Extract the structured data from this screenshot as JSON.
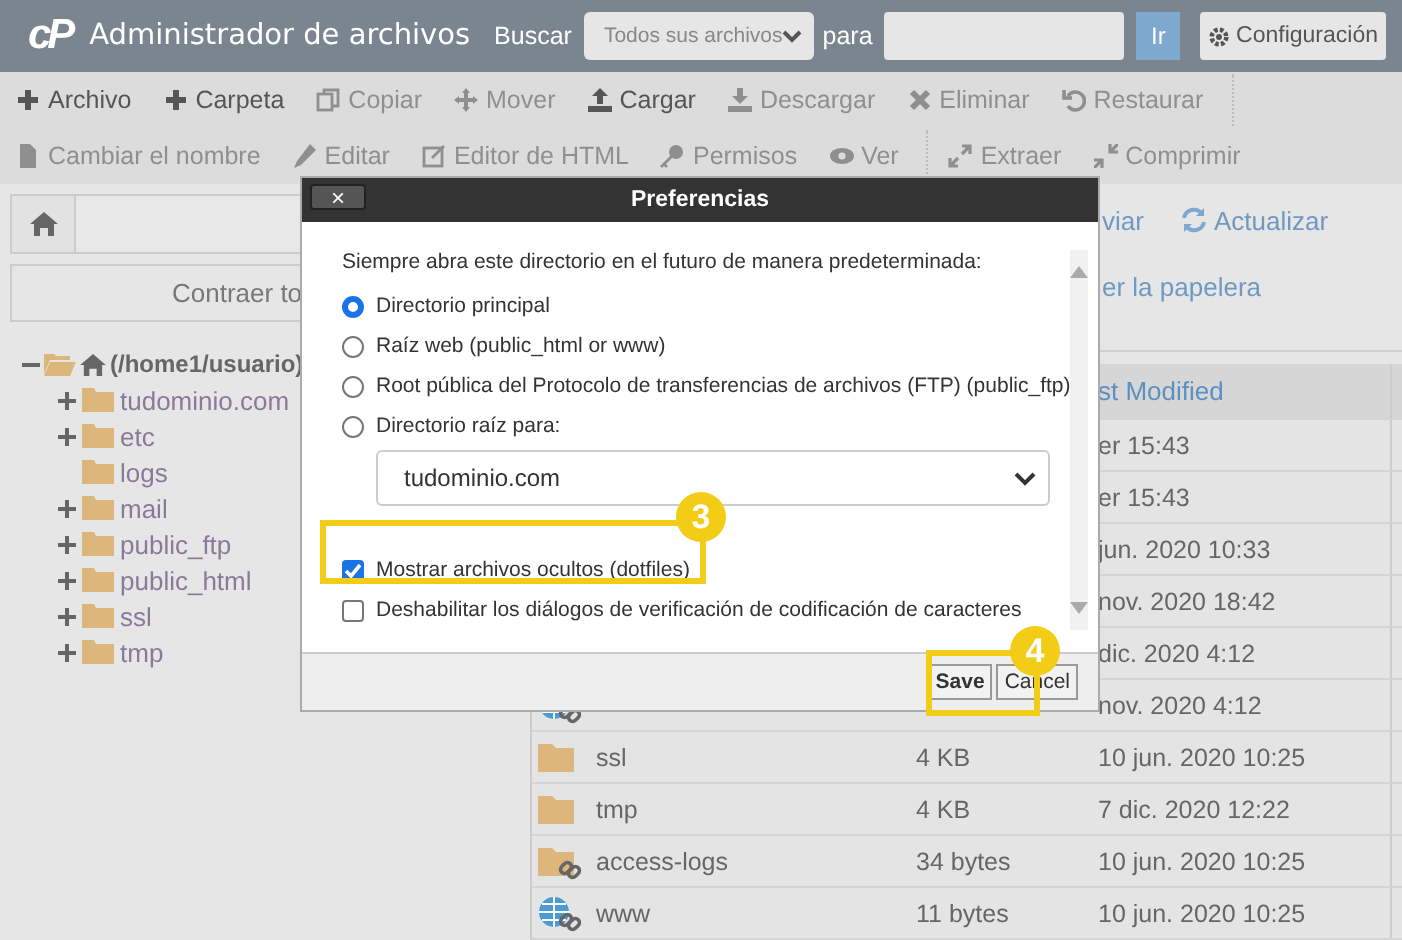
{
  "header": {
    "logo": "cP",
    "title": "Administrador de archivos",
    "search_label": "Buscar",
    "scope": "Todos sus archivos",
    "for_label": "para",
    "go": "Ir",
    "settings": "Configuración"
  },
  "toolbar": [
    [
      {
        "label": "Archivo",
        "disabled": false
      },
      {
        "label": "Carpeta",
        "disabled": false
      },
      {
        "label": "Copiar",
        "disabled": true
      },
      {
        "label": "Mover",
        "disabled": true
      },
      {
        "label": "Cargar",
        "disabled": false
      },
      {
        "label": "Descargar",
        "disabled": true
      },
      {
        "label": "Eliminar",
        "disabled": true
      },
      {
        "label": "Restaurar",
        "disabled": true
      }
    ],
    [
      {
        "label": "Cambiar el nombre",
        "disabled": true
      },
      {
        "label": "Editar",
        "disabled": true
      },
      {
        "label": "Editor de HTML",
        "disabled": true
      },
      {
        "label": "Permisos",
        "disabled": true
      },
      {
        "label": "Ver",
        "disabled": true
      },
      {
        "label": "Extraer",
        "disabled": true
      },
      {
        "label": "Comprimir",
        "disabled": true
      }
    ]
  ],
  "sidebar": {
    "collapse_button": "Contraer to",
    "tree": {
      "label": "(/home1/usuario)",
      "expanded": true,
      "children": [
        {
          "label": "tudominio.com",
          "expandable": true
        },
        {
          "label": "etc",
          "expandable": true
        },
        {
          "label": "logs",
          "expandable": false
        },
        {
          "label": "mail",
          "expandable": true
        },
        {
          "label": "public_ftp",
          "expandable": true
        },
        {
          "label": "public_html",
          "expandable": true
        },
        {
          "label": "ssl",
          "expandable": true
        },
        {
          "label": "tmp",
          "expandable": true
        }
      ]
    }
  },
  "actions": {
    "button_1": "viar",
    "refresh": "Actualizar",
    "trash_link": "er la papelera"
  },
  "table": {
    "columns": [
      "st Modified"
    ],
    "rows": [
      {
        "modified": "er 15:43"
      },
      {
        "modified": "er 15:43"
      },
      {
        "modified": "jun. 2020 10:33"
      },
      {
        "modified": "nov. 2020 18:42"
      },
      {
        "modified": "dic. 2020 4:12"
      },
      {
        "kind": "site",
        "modified": "nov. 2020 4:12"
      },
      {
        "kind": "folder",
        "name": "ssl",
        "size": "4 KB",
        "modified": "10 jun. 2020 10:25"
      },
      {
        "kind": "folder",
        "name": "tmp",
        "size": "4 KB",
        "modified": "7 dic. 2020 12:22"
      },
      {
        "kind": "link",
        "name": "access-logs",
        "size": "34 bytes",
        "modified": "10 jun. 2020 10:25"
      },
      {
        "kind": "site",
        "name": "www",
        "size": "11 bytes",
        "modified": "10 jun. 2020 10:25"
      }
    ]
  },
  "dialog": {
    "title": "Preferencias",
    "close": "×",
    "intro": "Siempre abra este directorio en el futuro de manera predeterminada:",
    "options": [
      {
        "label": "Directorio principal",
        "selected": true
      },
      {
        "label": "Raíz web (public_html or www)",
        "selected": false
      },
      {
        "label": "Root pública del Protocolo de transferencias de archivos (FTP) (public_ftp)",
        "selected": false
      },
      {
        "label": "Directorio raíz para:",
        "selected": false
      }
    ],
    "domain": "tudominio.com",
    "checkboxes": [
      {
        "label": "Mostrar archivos ocultos (dotfiles)",
        "checked": true
      },
      {
        "label": "Deshabilitar los diálogos de verificación de codificación de caracteres",
        "checked": false
      }
    ],
    "save": "Save",
    "cancel": "Cancel"
  },
  "callouts": [
    "3",
    "4"
  ]
}
